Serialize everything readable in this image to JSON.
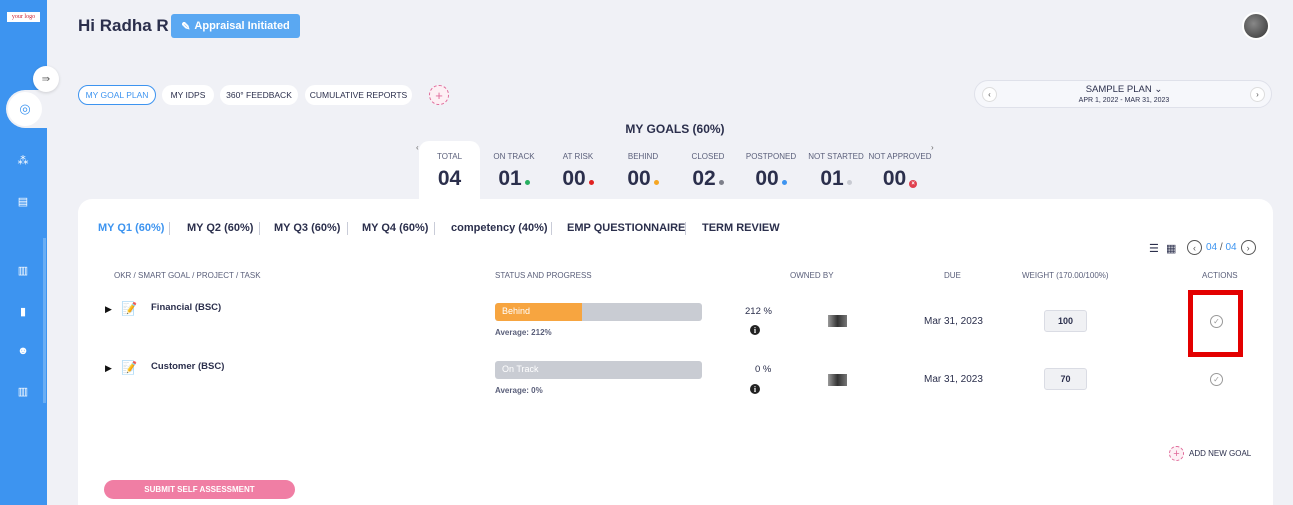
{
  "sidebar": {
    "logo_text": "your logo",
    "icons": [
      "collapse-icon",
      "target-icon",
      "hierarchy-icon",
      "document-icon",
      "chart-icon",
      "book-icon",
      "team-icon",
      "report-icon"
    ]
  },
  "header": {
    "greeting": "Hi Radha R",
    "appraisal_button": "Appraisal Initiated"
  },
  "nav_tabs": [
    {
      "label": "MY GOAL PLAN",
      "active": true
    },
    {
      "label": "MY IDPS"
    },
    {
      "label": "360° FEEDBACK"
    },
    {
      "label": "CUMULATIVE REPORTS"
    }
  ],
  "plan": {
    "title": "SAMPLE PLAN",
    "date_range": "APR 1, 2022 - MAR 31, 2023"
  },
  "summary": {
    "title": "MY GOALS (60%)",
    "stats": [
      {
        "label": "TOTAL",
        "value": "04"
      },
      {
        "label": "ON TRACK",
        "value": "01",
        "color": "#27ae60"
      },
      {
        "label": "AT RISK",
        "value": "00",
        "color": "#e02020"
      },
      {
        "label": "BEHIND",
        "value": "00",
        "color": "#f5a623"
      },
      {
        "label": "CLOSED",
        "value": "02",
        "color": "#7d7f8a"
      },
      {
        "label": "POSTPONED",
        "value": "00",
        "color": "#3d94f0"
      },
      {
        "label": "NOT STARTED",
        "value": "01",
        "color": "#c8cad2"
      },
      {
        "label": "NOT APPROVED",
        "value": "00",
        "color": "#e0404e"
      }
    ]
  },
  "quarter_tabs": [
    {
      "label": "MY Q1 (60%)",
      "active": true
    },
    {
      "label": "MY Q2 (60%)"
    },
    {
      "label": "MY Q3 (60%)"
    },
    {
      "label": "MY Q4 (60%)"
    },
    {
      "label": "competency (40%)"
    },
    {
      "label": "EMP QUESTIONNAIRE"
    },
    {
      "label": "TERM REVIEW"
    }
  ],
  "pager": {
    "current": "04",
    "total": "04"
  },
  "table": {
    "headers": {
      "goal": "OKR / SMART GOAL / PROJECT / TASK",
      "status": "STATUS AND PROGRESS",
      "owned": "OWNED BY",
      "due": "DUE",
      "weight": "WEIGHT (170.00/100%)",
      "actions": "ACTIONS"
    },
    "rows": [
      {
        "name": "Financial (BSC)",
        "status": "Behind",
        "progress_fraction": 0.42,
        "status_color": "#f7a540",
        "average": "Average: 212%",
        "percent": "212 %",
        "due": "Mar 31, 2023",
        "weight": "100"
      },
      {
        "name": "Customer (BSC)",
        "status": "On Track",
        "progress_fraction": 0,
        "status_color": "#c9ccd3",
        "average": "Average: 0%",
        "percent": "0 %",
        "due": "Mar 31, 2023",
        "weight": "70"
      }
    ]
  },
  "add_goal": "ADD NEW GOAL",
  "submit_button": "SUBMIT SELF ASSESSMENT"
}
